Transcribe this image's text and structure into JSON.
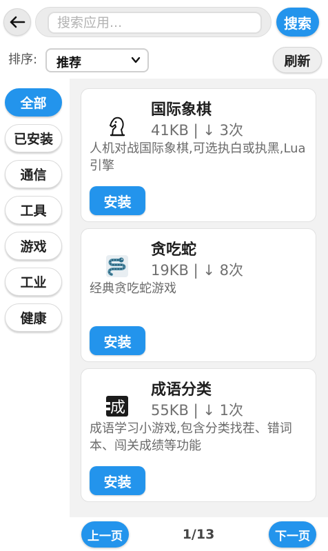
{
  "header": {
    "back_icon": "arrow-left-icon",
    "search_placeholder": "搜索应用...",
    "search_label": "搜索"
  },
  "sort": {
    "label": "排序:",
    "selected": "推荐",
    "refresh_label": "刷新"
  },
  "categories": [
    {
      "label": "全部",
      "active": true
    },
    {
      "label": "已安装",
      "active": false
    },
    {
      "label": "通信",
      "active": false
    },
    {
      "label": "工具",
      "active": false
    },
    {
      "label": "游戏",
      "active": false
    },
    {
      "label": "工业",
      "active": false
    },
    {
      "label": "健康",
      "active": false
    }
  ],
  "apps": [
    {
      "name": "国际象棋",
      "meta": "41KB | ↓ 3次",
      "description": "人机对战国际象棋,可选执白或执黑,Lua 引擎",
      "icon": "chess-knight-icon",
      "install_label": "安装"
    },
    {
      "name": "贪吃蛇",
      "meta": "19KB | ↓ 8次",
      "description": "经典贪吃蛇游戏",
      "icon": "snake-icon",
      "install_label": "安装"
    },
    {
      "name": "成语分类",
      "meta": "55KB | ↓ 1次",
      "description": "成语学习小游戏,包含分类找茬、错词本、闯关成绩等功能",
      "icon": "idiom-cheng-icon",
      "install_label": "安装"
    }
  ],
  "pagination": {
    "prev_label": "上一页",
    "indicator": "1/13",
    "next_label": "下一页"
  },
  "colors": {
    "accent": "#2394ec",
    "list_background": "#f2f2f2"
  }
}
